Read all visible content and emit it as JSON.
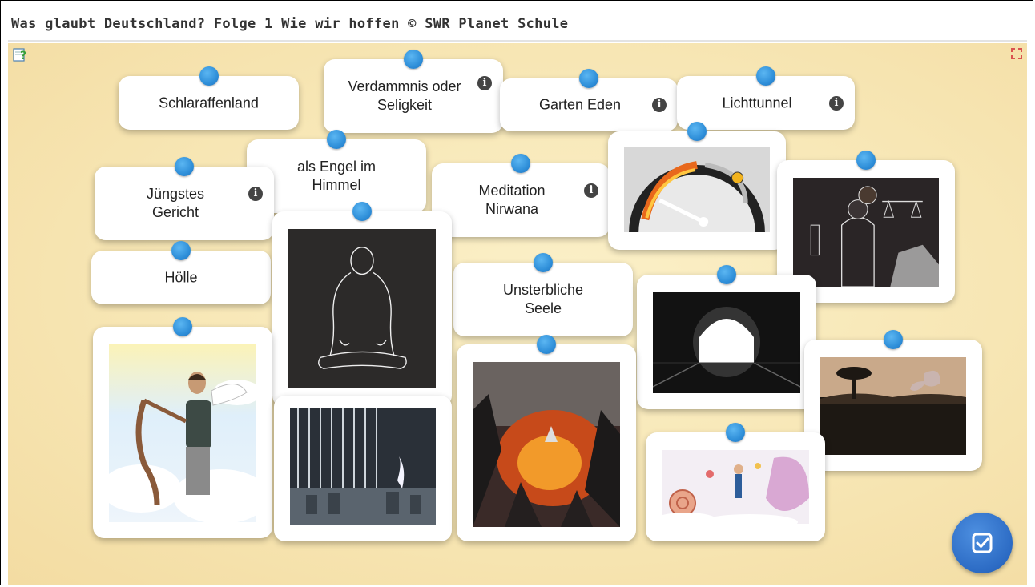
{
  "header": {
    "title": "Was glaubt Deutschland? Folge 1 Wie wir hoffen © SWR Planet Schule"
  },
  "toolbar": {
    "help_icon": "help-question-icon",
    "fullscreen_icon": "fullscreen-icon"
  },
  "cards": {
    "schlaraffenland": "Schlaraffenland",
    "verdammnis": "Verdammnis oder Seligkeit",
    "garten_eden": "Garten Eden",
    "lichttunnel": "Lichttunnel",
    "engel": "als Engel im Himmel",
    "juengstes_gericht": "Jüngstes Gericht",
    "meditation": "Meditation Nirwana",
    "hoelle": "Hölle",
    "seele": "Unsterbliche Seele"
  },
  "info_symbol": "i",
  "images": [
    "gauge-fire-image",
    "justice-scale-image",
    "meditating-figure-image",
    "tunnel-light-image",
    "angel-harp-image",
    "graveyard-gate-image",
    "burning-city-image",
    "butterfly-savanna-image",
    "candy-land-image"
  ],
  "actions": {
    "check_icon": "check-square-icon"
  },
  "colors": {
    "pin": "#2f8fd9",
    "board": "#f7e6b4",
    "check_button": "#2c6bc4"
  }
}
